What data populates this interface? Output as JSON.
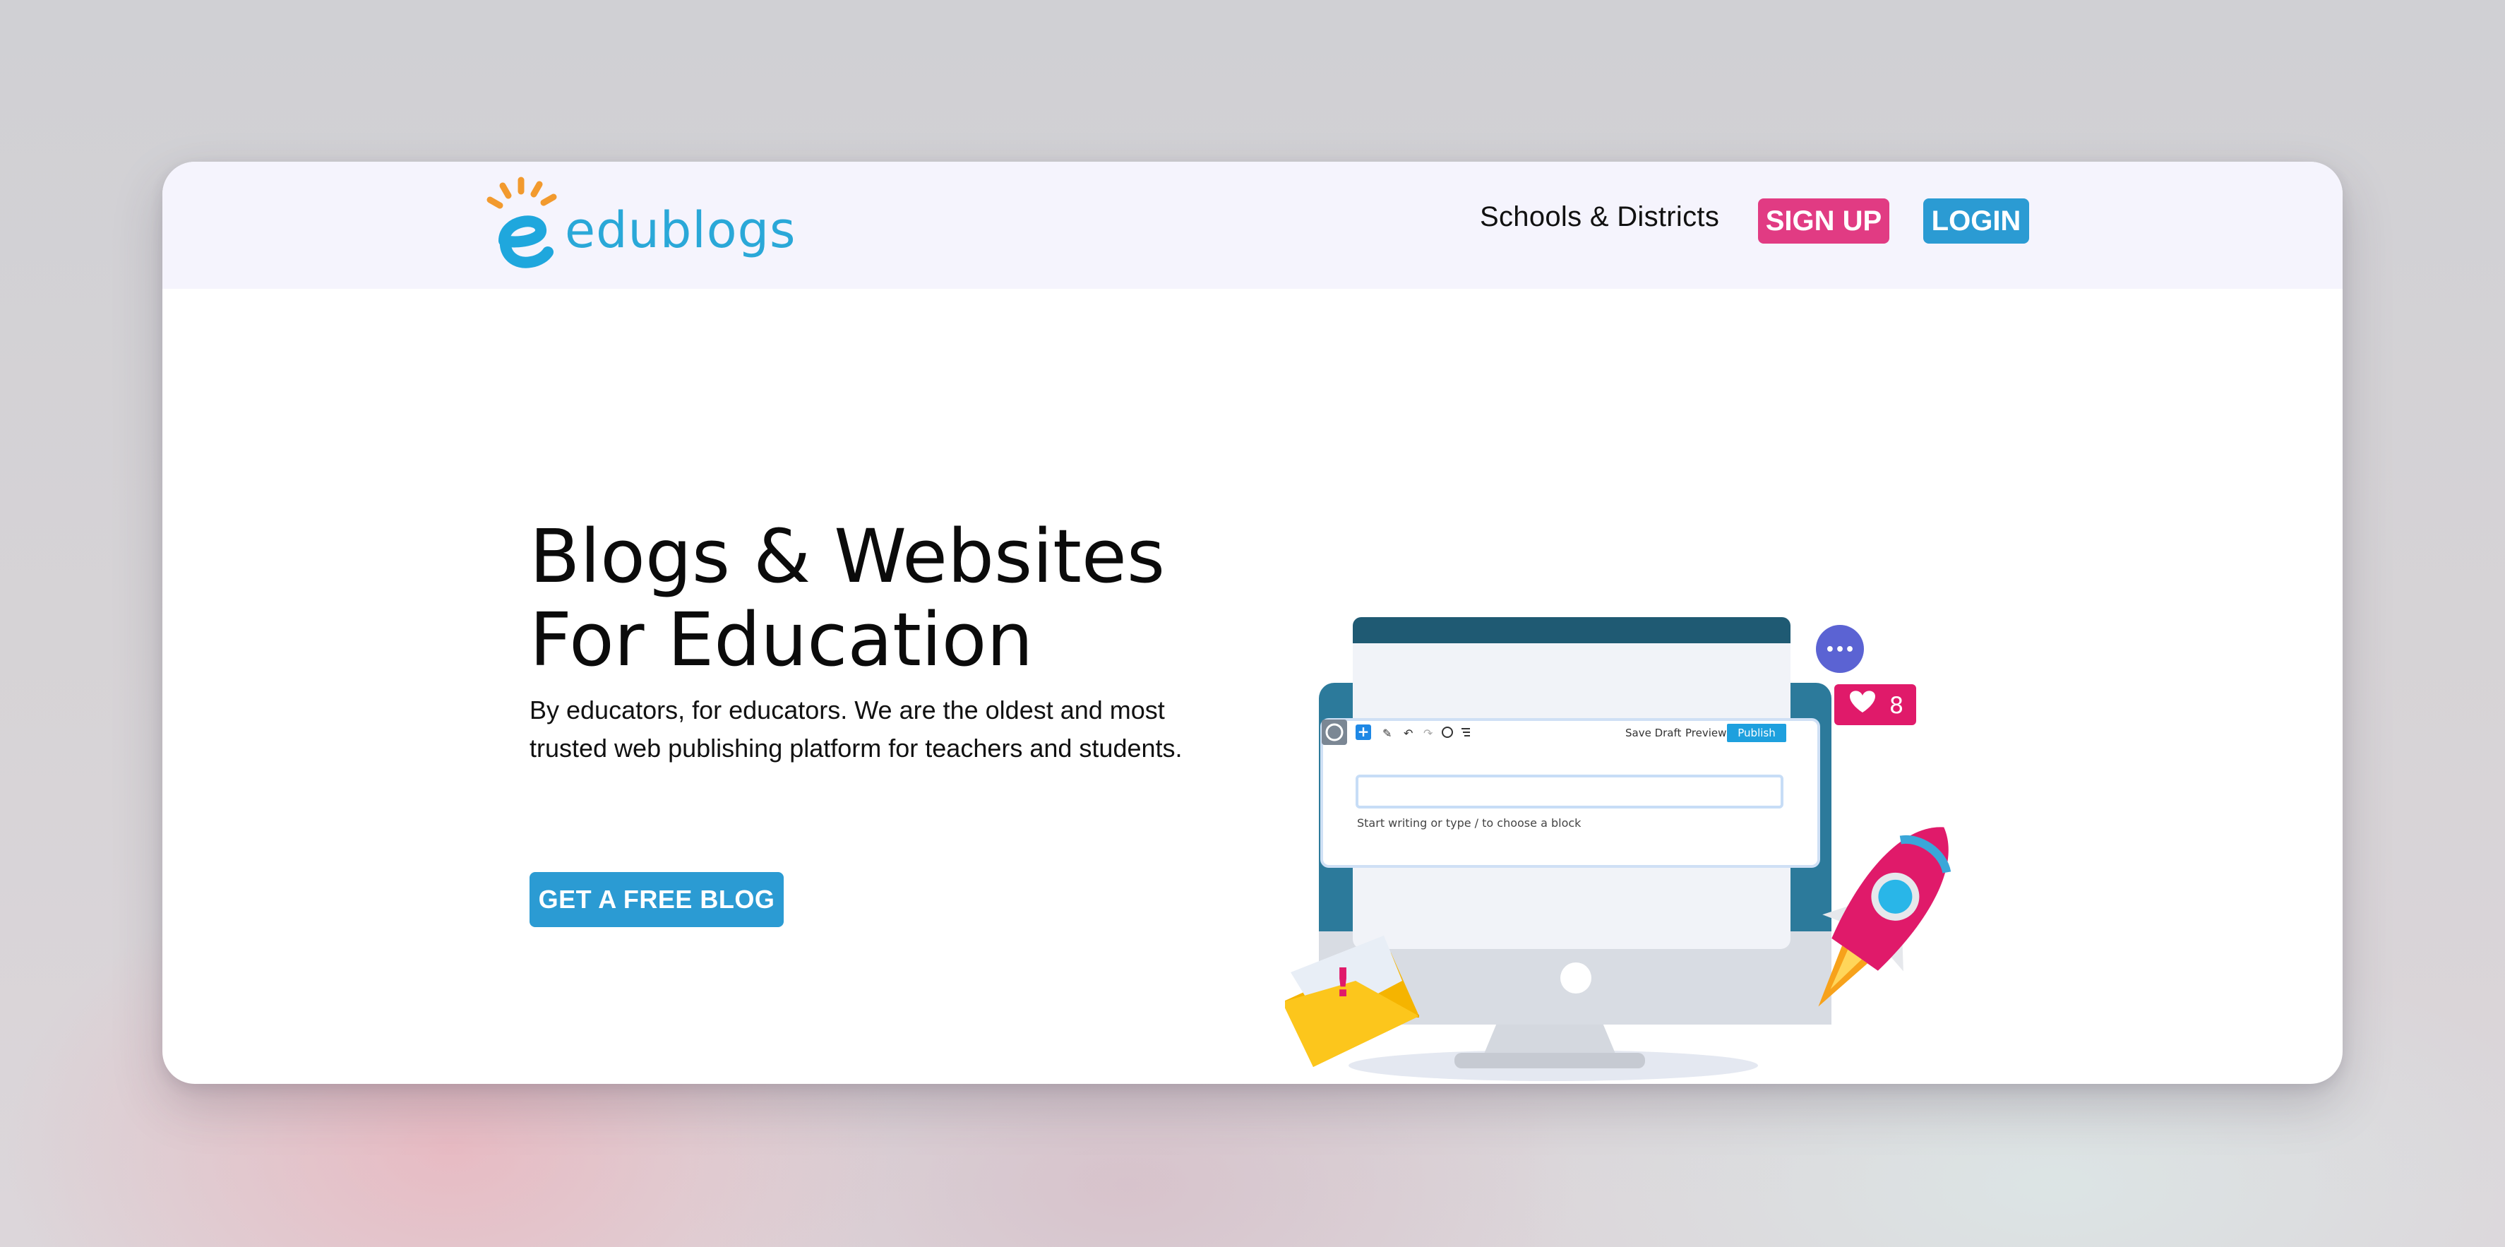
{
  "header": {
    "logo_text": "edublogs",
    "nav_link": "Schools & Districts",
    "signup_label": "SIGN UP",
    "login_label": "LOGIN"
  },
  "hero": {
    "title_line1": "Blogs & Websites",
    "title_line2": "For Education",
    "subtitle": "By educators, for educators. We are the oldest and most trusted web publishing platform for teachers and students.",
    "cta_label": "GET A FREE BLOG"
  },
  "illustration": {
    "editor": {
      "save_draft": "Save Draft",
      "preview": "Preview",
      "publish": "Publish",
      "placeholder": "Start writing or type / to choose a block"
    },
    "like_count": "8",
    "alert_mark": "!",
    "chat_dots": "•••"
  },
  "colors": {
    "brand_blue": "#2aa8d8",
    "signup_pink": "#e13b83",
    "login_blue": "#2b9bd3",
    "monitor_dark": "#1f5a73",
    "rocket_pink": "#e01a6a"
  },
  "icons": {
    "logo": "edublogs-sun-e-logo",
    "wordpress": "wordpress-icon",
    "add_block": "plus-icon",
    "edit": "pencil-icon",
    "undo": "undo-icon",
    "redo": "redo-icon",
    "info": "info-icon",
    "outline": "list-icon",
    "settings": "gear-icon",
    "chat": "chat-bubble-icon",
    "heart": "heart-icon",
    "mail": "envelope-icon",
    "rocket": "rocket-icon"
  }
}
